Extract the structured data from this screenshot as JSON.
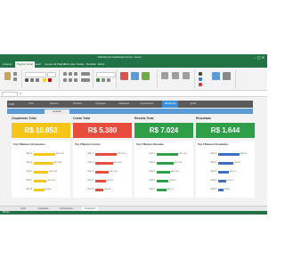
{
  "window": {
    "title": "Planilha de Dashboard Excel - Excel"
  },
  "ribbon_tabs": [
    "Arquivo",
    "Página Inicial",
    "Inserir",
    "Layout da Página",
    "Fórmulas",
    "Dados",
    "Revisão",
    "Exibir"
  ],
  "active_tab_index": 1,
  "menu": {
    "logo": "LUZ",
    "items": [
      "Início",
      "Resumo",
      "Receitas",
      "Despesas",
      "Categorias",
      "Lançamentos",
      "Dashboard",
      "Ajuda"
    ],
    "active_index": 6
  },
  "subbar": {
    "button_label": "Atualizar"
  },
  "kpis": [
    {
      "title": "Orçamento Total",
      "value": "R$ 10.853",
      "color": "#f5c518"
    },
    {
      "title": "Custo Total",
      "value": "R$ 5.380",
      "color": "#e74c3c"
    },
    {
      "title": "Receita Total",
      "value": "R$ 7.024",
      "color": "#2e9e48"
    },
    {
      "title": "Resultado",
      "value": "R$ 1.644",
      "color": "#2e9e48"
    }
  ],
  "cards": [
    {
      "title": "Top 5 Maiores Orçamentos",
      "color": "#f5c518",
      "rows": [
        {
          "label": "Item 1",
          "value": 1,
          "display": "R$ 3.542"
        },
        {
          "label": "Item 2",
          "value": 0.9,
          "display": "R$ 2.861"
        },
        {
          "label": "Item 3",
          "value": 0.68,
          "display": "R$ 2.024"
        },
        {
          "label": "Item 4",
          "value": 0.6,
          "display": "R$ 1.622"
        },
        {
          "label": "Item 5",
          "value": 0.48,
          "display": "R$ 804"
        }
      ]
    },
    {
      "title": "Top 5 Maiores Custos",
      "color": "#e74c3c",
      "rows": [
        {
          "label": "Item 1",
          "value": 1,
          "display": "R$ 1.842"
        },
        {
          "label": "Item 2",
          "value": 0.82,
          "display": "R$ 1.438"
        },
        {
          "label": "Item 3",
          "value": 0.62,
          "display": "R$ 1.042"
        },
        {
          "label": "Item 4",
          "value": 0.5,
          "display": "R$ 652"
        },
        {
          "label": "Item 5",
          "value": 0.38,
          "display": "R$ 406"
        }
      ]
    },
    {
      "title": "Top 5 Maiores Receitas",
      "color": "#2e9e48",
      "rows": [
        {
          "label": "Item 1",
          "value": 1,
          "display": "R$ 2.451"
        },
        {
          "label": "Item 2",
          "value": 0.78,
          "display": "R$ 1.832"
        },
        {
          "label": "Item 3",
          "value": 0.62,
          "display": "R$ 1.304"
        },
        {
          "label": "Item 4",
          "value": 0.55,
          "display": "R$ 924"
        },
        {
          "label": "Item 5",
          "value": 0.45,
          "display": "R$ 513"
        }
      ]
    },
    {
      "title": "Top 5 Maiores Resultados",
      "color": "#3b6fc4",
      "rows": [
        {
          "label": "Item 1",
          "value": 1,
          "display": "R$ 842"
        },
        {
          "label": "Item 2",
          "value": 0.72,
          "display": "R$ 421"
        },
        {
          "label": "Item 3",
          "value": 0.5,
          "display": "R$ 214"
        },
        {
          "label": "Item 4",
          "value": 0.36,
          "display": "R$ 109"
        },
        {
          "label": "Item 5",
          "value": 0.25,
          "display": "R$ 58"
        }
      ]
    }
  ],
  "sheet_tabs": [
    "Início",
    "Cadastros",
    "Lançamentos",
    "Dashboard"
  ],
  "active_sheet_index": 3,
  "status": {
    "text": "Pronto"
  }
}
